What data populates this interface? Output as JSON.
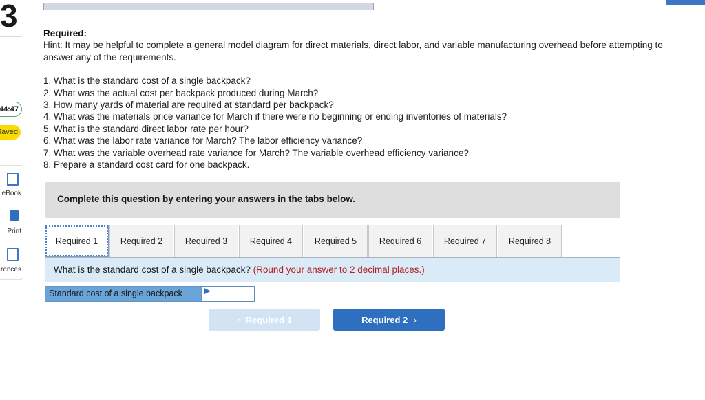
{
  "question_number": "3",
  "timer": "44:47",
  "saved_badge": "Saved",
  "rail_items": [
    {
      "label": "eBook",
      "icon": "book-icon"
    },
    {
      "label": "Print",
      "icon": "printer-icon"
    },
    {
      "label": "References",
      "icon": "references-icon"
    }
  ],
  "required_heading": "Required:",
  "hint": "Hint:  It may be helpful to complete a general model diagram for direct materials, direct labor, and variable manufacturing overhead before attempting to answer any of the requirements.",
  "questions": [
    "1. What is the standard cost of a single backpack?",
    "2. What was the actual cost per backpack produced during March?",
    "3. How many yards of material are required at standard per backpack?",
    "4. What was the materials price variance for March if there were no beginning or ending inventories of materials?",
    "5. What is the standard direct labor rate per hour?",
    "6. What was the labor rate variance for March? The labor efficiency variance?",
    "7. What was the variable overhead rate variance for March? The variable overhead efficiency variance?",
    "8. Prepare a standard cost card for one backpack."
  ],
  "instruction_banner": "Complete this question by entering your answers in the tabs below.",
  "tabs": [
    {
      "label": "Required 1",
      "active": true
    },
    {
      "label": "Required 2",
      "active": false
    },
    {
      "label": "Required 3",
      "active": false
    },
    {
      "label": "Required 4",
      "active": false
    },
    {
      "label": "Required 5",
      "active": false
    },
    {
      "label": "Required 6",
      "active": false
    },
    {
      "label": "Required 7",
      "active": false
    },
    {
      "label": "Required 8",
      "active": false
    }
  ],
  "prompt": {
    "question": "What is the standard cost of a single backpack?",
    "rounding_note": "(Round your answer to 2 decimal places.)"
  },
  "answer_row": {
    "label": "Standard cost of a single backpack",
    "value": "",
    "placeholder": ""
  },
  "nav": {
    "prev_label": "Required 1",
    "prev_chevron": "‹",
    "next_label": "Required 2",
    "next_chevron": "›"
  },
  "colors": {
    "accent_blue": "#2f6fc0",
    "prompt_bg": "#daeaf7",
    "banner_bg": "#dedede",
    "label_cell": "#6ba4d8",
    "note_red": "#b42121",
    "saved_yellow": "#fada00"
  }
}
